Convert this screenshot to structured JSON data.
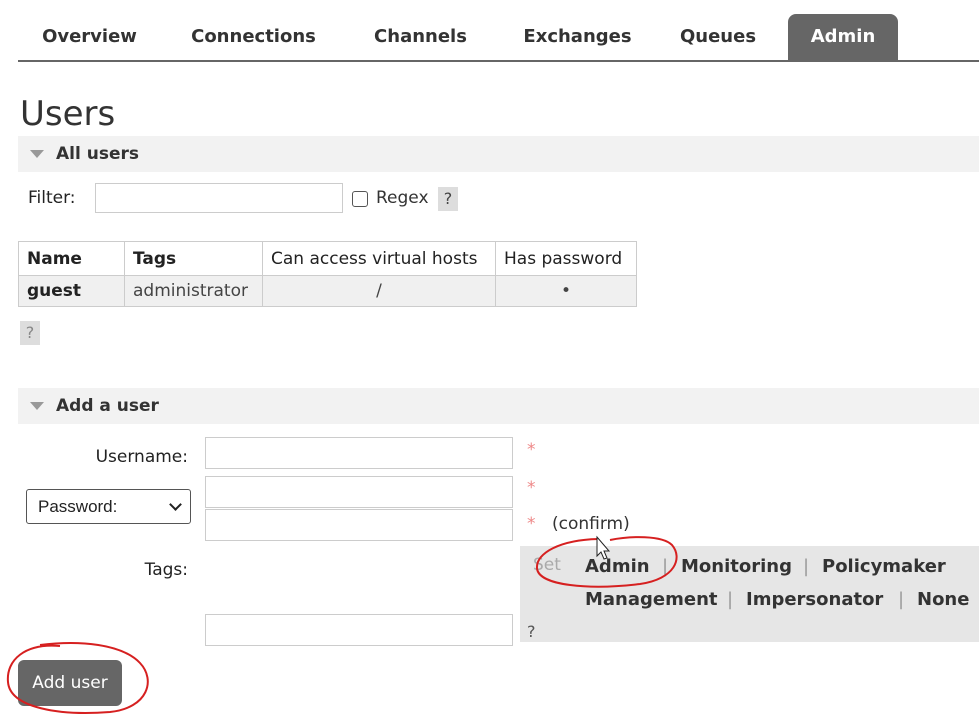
{
  "nav": {
    "tabs": [
      {
        "label": "Overview"
      },
      {
        "label": "Connections"
      },
      {
        "label": "Channels"
      },
      {
        "label": "Exchanges"
      },
      {
        "label": "Queues"
      },
      {
        "label": "Admin",
        "active": true
      }
    ]
  },
  "page": {
    "title": "Users"
  },
  "all_users": {
    "header": "All users",
    "filter_label": "Filter:",
    "filter_value": "",
    "regex_label": "Regex",
    "regex_checked": false,
    "help": "?",
    "table": {
      "columns": [
        "Name",
        "Tags",
        "Can access virtual hosts",
        "Has password"
      ],
      "rows": [
        {
          "name": "guest",
          "tags": "administrator",
          "vhosts": "/",
          "has_password": "•"
        }
      ]
    },
    "table_help": "?"
  },
  "add_user": {
    "header": "Add a user",
    "username_label": "Username:",
    "username_value": "",
    "password_mode": "Password:",
    "password_value": "",
    "confirm_value": "",
    "required_mark": "*",
    "confirm_label": "(confirm)",
    "tags_label": "Tags:",
    "tags_value": "",
    "tags_help": "?",
    "tag_set_label": "Set",
    "tag_options": [
      "Admin",
      "Monitoring",
      "Policymaker",
      "Management",
      "Impersonator",
      "None"
    ],
    "separator": "|",
    "submit_label": "Add user"
  },
  "colors": {
    "tab_active_bg": "#666666",
    "section_bg": "#f2f2f2",
    "required": "#ee8888",
    "annotation": "#d62020"
  }
}
